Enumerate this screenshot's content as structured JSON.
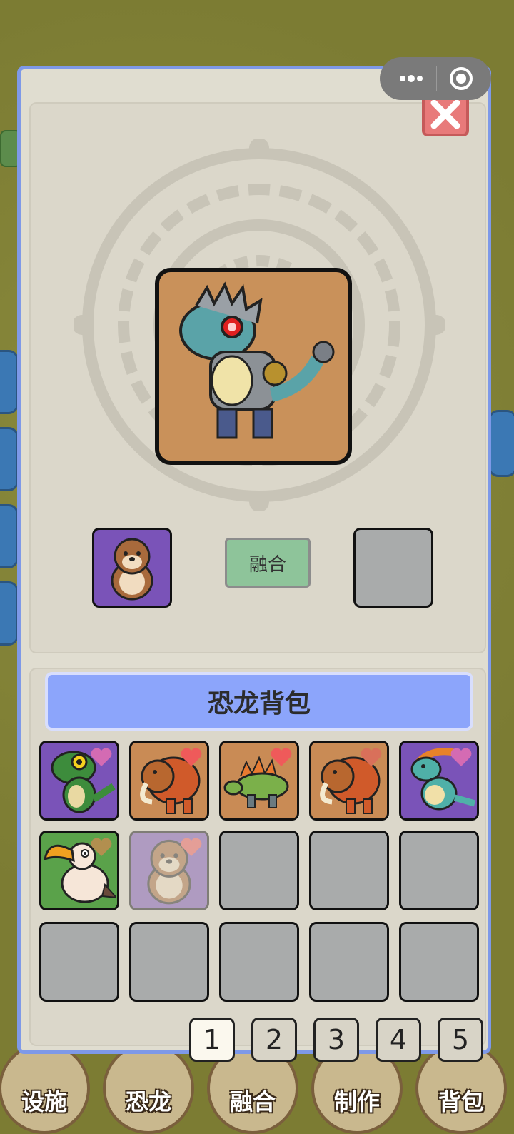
{
  "panel": {
    "fuse_button": "融合",
    "bag_title": "恐龙背包"
  },
  "bag": {
    "cells": [
      {
        "creature": "t-rex-green",
        "bg": "purple",
        "heart": true
      },
      {
        "creature": "mammoth",
        "bg": "orange",
        "heart": true
      },
      {
        "creature": "stegosaurus",
        "bg": "orange",
        "heart": true
      },
      {
        "creature": "mammoth",
        "bg": "orange",
        "heart": true
      },
      {
        "creature": "parasaurolophus",
        "bg": "purple",
        "heart": true
      },
      {
        "creature": "dodo-bird",
        "bg": "green",
        "heart": true
      },
      {
        "creature": "beaver",
        "bg": "purple",
        "heart": true,
        "faded": true
      },
      {
        "creature": "",
        "bg": "empty"
      },
      {
        "creature": "",
        "bg": "empty"
      },
      {
        "creature": "",
        "bg": "empty"
      },
      {
        "creature": "",
        "bg": "empty"
      },
      {
        "creature": "",
        "bg": "empty"
      },
      {
        "creature": "",
        "bg": "empty"
      },
      {
        "creature": "",
        "bg": "empty"
      },
      {
        "creature": "",
        "bg": "empty"
      }
    ],
    "pages": [
      "1",
      "2",
      "3",
      "4",
      "5"
    ],
    "active_page": "1"
  },
  "fusion": {
    "main_creature": "mecha-t-rex",
    "input_creature": "beaver",
    "output_creature": ""
  },
  "nav": {
    "items": [
      {
        "label": "设施"
      },
      {
        "label": "恐龙"
      },
      {
        "label": "融合"
      },
      {
        "label": "制作"
      },
      {
        "label": "背包"
      }
    ]
  },
  "colors": {
    "panel_border": "#7e99e8",
    "bag_title_bg": "#8ca5fb",
    "fuse_button_bg": "#8ec49a",
    "close_button_bg": "#e87a7a",
    "empty_cell": "#a9abab"
  }
}
